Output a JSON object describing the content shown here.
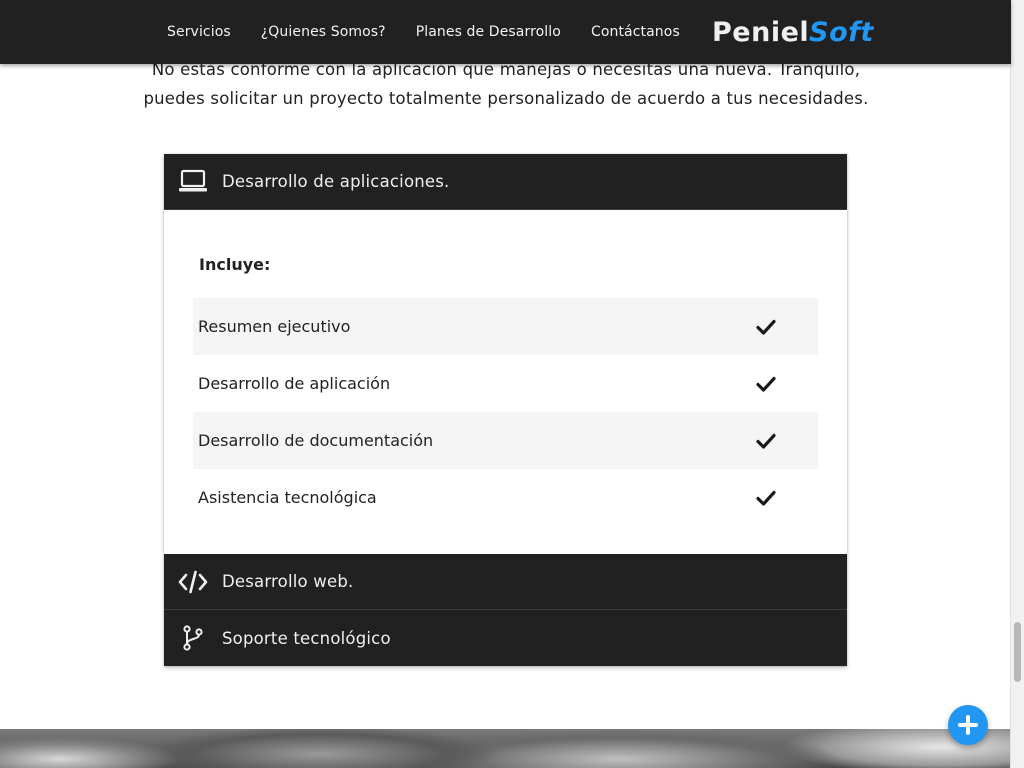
{
  "nav": {
    "links": [
      "Servicios",
      "¿Quienes Somos?",
      "Planes de Desarrollo",
      "Contáctanos"
    ],
    "brand_part1": "Peniel",
    "brand_part2": "Soft",
    "brand_accent_color": "#2196f3"
  },
  "intro": {
    "line1": "No estás conforme con la aplicación que manejas o necesitas una nueva. Tranquilo,",
    "line2": "puedes solicitar un proyecto totalmente personalizado de acuerdo a tus necesidades."
  },
  "collapsible": {
    "sections": [
      {
        "icon": "laptop-icon",
        "label": "Desarrollo de aplicaciones.",
        "expanded": true
      },
      {
        "icon": "code-icon",
        "label": "Desarrollo web.",
        "expanded": false
      },
      {
        "icon": "branch-icon",
        "label": "Soporte tecnológico",
        "expanded": false
      }
    ],
    "body": {
      "includes_label": "Incluye:",
      "items": [
        {
          "label": "Resumen ejecutivo",
          "icon": "check-icon"
        },
        {
          "label": "Desarrollo de aplicación",
          "icon": "check-icon"
        },
        {
          "label": "Desarrollo de documentación",
          "icon": "check-icon"
        },
        {
          "label": "Asistencia tecnológica",
          "icon": "check-icon"
        }
      ]
    }
  },
  "fab": {
    "icon": "plus-icon",
    "color": "#2196f3"
  }
}
